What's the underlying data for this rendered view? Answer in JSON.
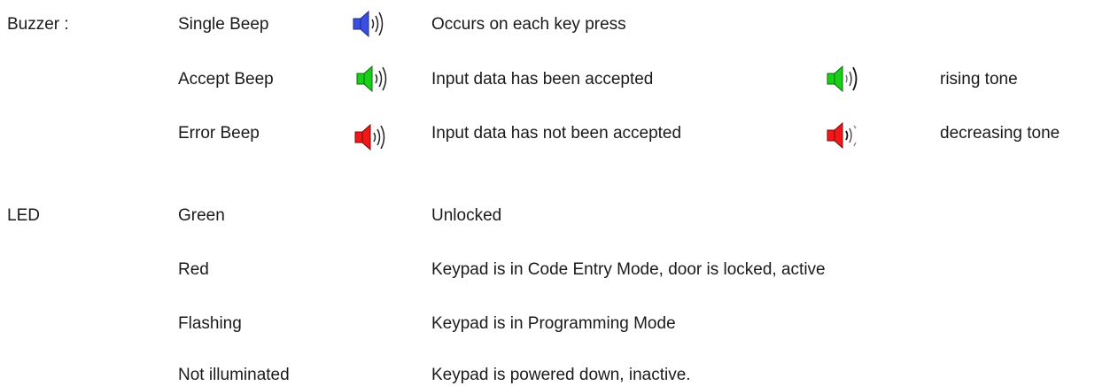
{
  "buzzer": {
    "label": "Buzzer :",
    "rows": [
      {
        "name": "Single Beep",
        "icon": "speaker-blue-icon",
        "color": "#3a4fe0",
        "description": "Occurs on each key press"
      },
      {
        "name": "Accept Beep",
        "icon": "speaker-green-icon",
        "color": "#18d018",
        "description": "Input data has been accepted",
        "tone_icon": "speaker-green-rising-icon",
        "tone_label": "rising tone"
      },
      {
        "name": "Error Beep",
        "icon": "speaker-red-icon",
        "color": "#f01818",
        "description": "Input data has not been accepted",
        "tone_icon": "speaker-red-decreasing-icon",
        "tone_label": "decreasing tone"
      }
    ]
  },
  "led": {
    "label": "LED",
    "rows": [
      {
        "state": "Green",
        "description": "Unlocked"
      },
      {
        "state": "Red",
        "description": "Keypad is in Code Entry Mode, door is locked, active"
      },
      {
        "state": "Flashing",
        "description": "Keypad is in Programming Mode"
      },
      {
        "state": "Not illuminated",
        "description": "Keypad is powered down, inactive."
      }
    ]
  }
}
